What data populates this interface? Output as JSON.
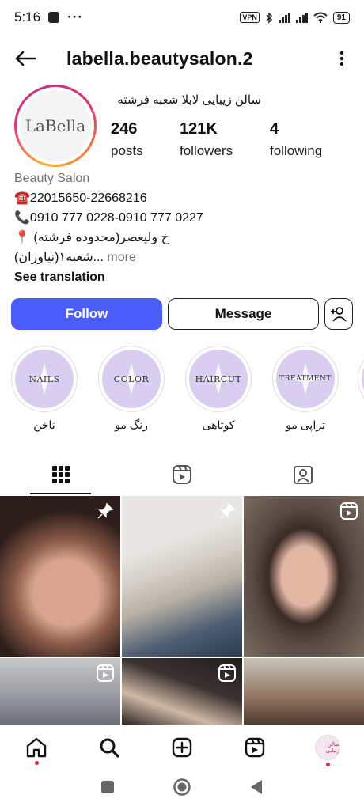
{
  "status_bar": {
    "time": "5:16",
    "dots": "···",
    "vpn": "VPN",
    "battery": "91"
  },
  "header": {
    "username": "labella.beautysalon.2"
  },
  "profile": {
    "avatar_text": "LaBella",
    "display_name": "سالن زیبایی لابلا شعبه فرشته",
    "stats": [
      {
        "value": "246",
        "label": "posts"
      },
      {
        "value": "121K",
        "label": "followers"
      },
      {
        "value": "4",
        "label": "following"
      }
    ],
    "category": "Beauty Salon",
    "bio_lines": [
      "☎️22015650-22668216",
      "📞0910 777 0228-0910 777 0227",
      "خ ولیعصر(محدوده فرشته) 📍",
      "شعبه۱(نیاوران)..."
    ],
    "more_label": " more",
    "see_translation": "See translation"
  },
  "actions": {
    "follow": "Follow",
    "message": "Message"
  },
  "highlights": [
    {
      "cover_text": "NAILS",
      "label": "ناخن"
    },
    {
      "cover_text": "COLOR",
      "label": "رنگ مو"
    },
    {
      "cover_text": "HAIRCUT",
      "label": "کوتاهی"
    },
    {
      "cover_text": "TREATMENT",
      "label": "تراپی مو"
    }
  ],
  "tabs": [
    "grid-icon",
    "reels-icon",
    "tagged-icon"
  ],
  "grid_posts": [
    {
      "badge": "pin-icon"
    },
    {
      "badge": "pin-icon"
    },
    {
      "badge": "reels-icon"
    },
    {
      "badge": "reels-icon"
    },
    {
      "badge": "reels-icon"
    },
    {
      "badge": ""
    }
  ],
  "bottom_nav": {
    "profile_avatar_text": "سالن زیبایی"
  },
  "colors": {
    "follow_button": "#4a5df9",
    "notification_dot": "#e02a3a"
  }
}
